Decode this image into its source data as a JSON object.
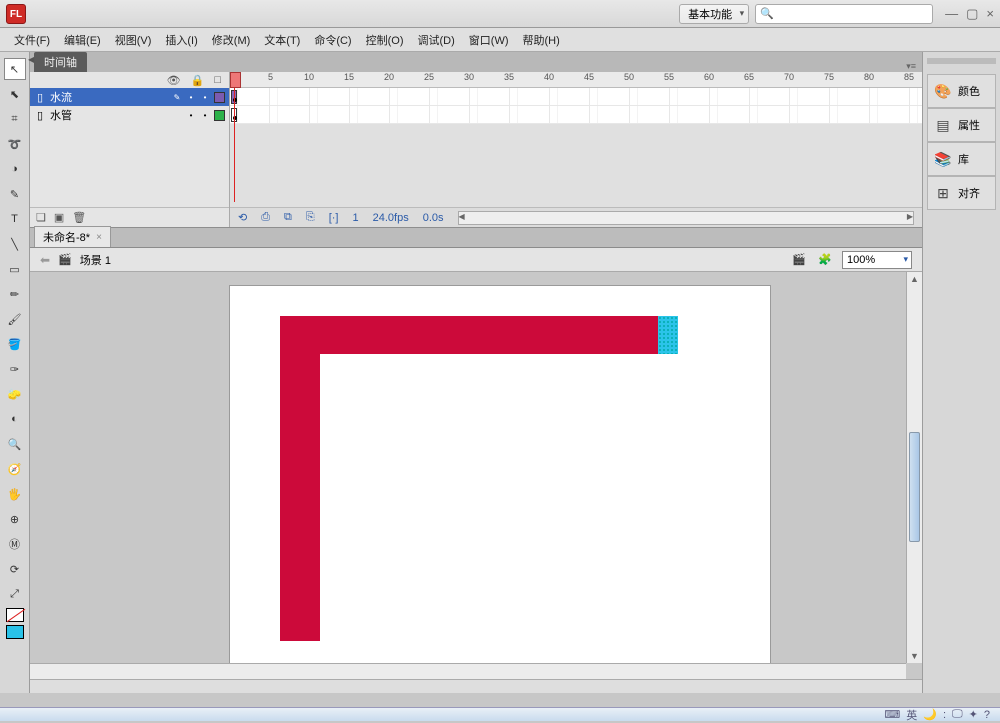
{
  "app": {
    "icon_label": "FL"
  },
  "workspace": {
    "label": "基本功能"
  },
  "search": {
    "placeholder": ""
  },
  "window_controls": {
    "min": "—",
    "max": "▢",
    "close": "×"
  },
  "menu": [
    {
      "label": "文件(F)"
    },
    {
      "label": "编辑(E)"
    },
    {
      "label": "视图(V)"
    },
    {
      "label": "插入(I)"
    },
    {
      "label": "修改(M)"
    },
    {
      "label": "文本(T)"
    },
    {
      "label": "命令(C)"
    },
    {
      "label": "控制(O)"
    },
    {
      "label": "调试(D)"
    },
    {
      "label": "窗口(W)"
    },
    {
      "label": "帮助(H)"
    }
  ],
  "timeline": {
    "tab": "时间轴",
    "ruler_marks": [
      1,
      5,
      10,
      15,
      20,
      25,
      30,
      35,
      40,
      45,
      50,
      55,
      60,
      65,
      70,
      75,
      80,
      85
    ],
    "layer_header": {
      "vis": "👁",
      "lock": "🔒",
      "outline": "□"
    },
    "layers": [
      {
        "name": "水流",
        "active": true,
        "color": "#7b5bb0"
      },
      {
        "name": "水管",
        "active": false,
        "color": "#2db24a"
      }
    ],
    "footer_icons": [
      "❏",
      "▣",
      "🗑"
    ],
    "status": {
      "icons": [
        "⟲",
        "⎙",
        "⧉",
        "⎘",
        "[·]"
      ],
      "frame": "1",
      "fps": "24.0fps",
      "time": "0.0s"
    }
  },
  "doc": {
    "tab_label": "未命名-8*",
    "scene_label": "场景 1",
    "zoom": "100%"
  },
  "right_panels": [
    {
      "icon": "🎨",
      "label": "颜色"
    },
    {
      "icon": "▤",
      "label": "属性"
    },
    {
      "icon": "📚",
      "label": "库"
    },
    {
      "icon": "⊞",
      "label": "对齐"
    }
  ],
  "tools": [
    "↖",
    "⬉",
    "⌗",
    "➰",
    "◑",
    "✎",
    "T",
    "╲",
    "▭",
    "✏",
    "🖌",
    "🪣",
    "✑",
    "🧽",
    "◐",
    "🔍",
    "🧭",
    "🖐",
    "⊕",
    "Ⓜ",
    "⟳",
    "⤢"
  ],
  "ime": {
    "items": [
      "⌨",
      "英",
      "🌙",
      ":",
      "🖵",
      "✦",
      "?"
    ]
  }
}
